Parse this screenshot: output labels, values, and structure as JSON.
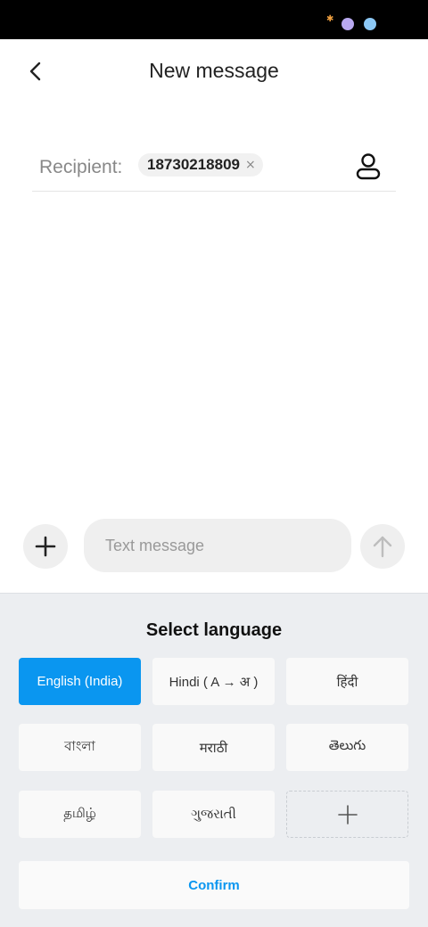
{
  "status_bar": {
    "icons": [
      "star-icon",
      "planet-icon",
      "circle-icon"
    ]
  },
  "header": {
    "title": "New message",
    "back_icon": "chevron-left-icon"
  },
  "recipient": {
    "label": "Recipient:",
    "chip_value": "18730218809",
    "chip_close": "×",
    "contact_icon": "person-icon"
  },
  "composer": {
    "add_icon": "plus-icon",
    "placeholder": "Text message",
    "send_icon": "arrow-up-icon"
  },
  "language_panel": {
    "title": "Select language",
    "languages": [
      {
        "label": "English (India)",
        "selected": true
      },
      {
        "label": "Hindi ( A → अ )",
        "selected": false
      },
      {
        "label": "हिंदी",
        "selected": false
      },
      {
        "label": "বাংলা",
        "selected": false
      },
      {
        "label": "मराठी",
        "selected": false
      },
      {
        "label": "తెలుగు",
        "selected": false
      },
      {
        "label": "தமிழ்",
        "selected": false
      },
      {
        "label": "ગુજરાતી",
        "selected": false
      }
    ],
    "add_icon": "plus-icon",
    "confirm_label": "Confirm"
  },
  "colors": {
    "accent": "#0a96f0",
    "panel_bg": "#eceef1"
  }
}
